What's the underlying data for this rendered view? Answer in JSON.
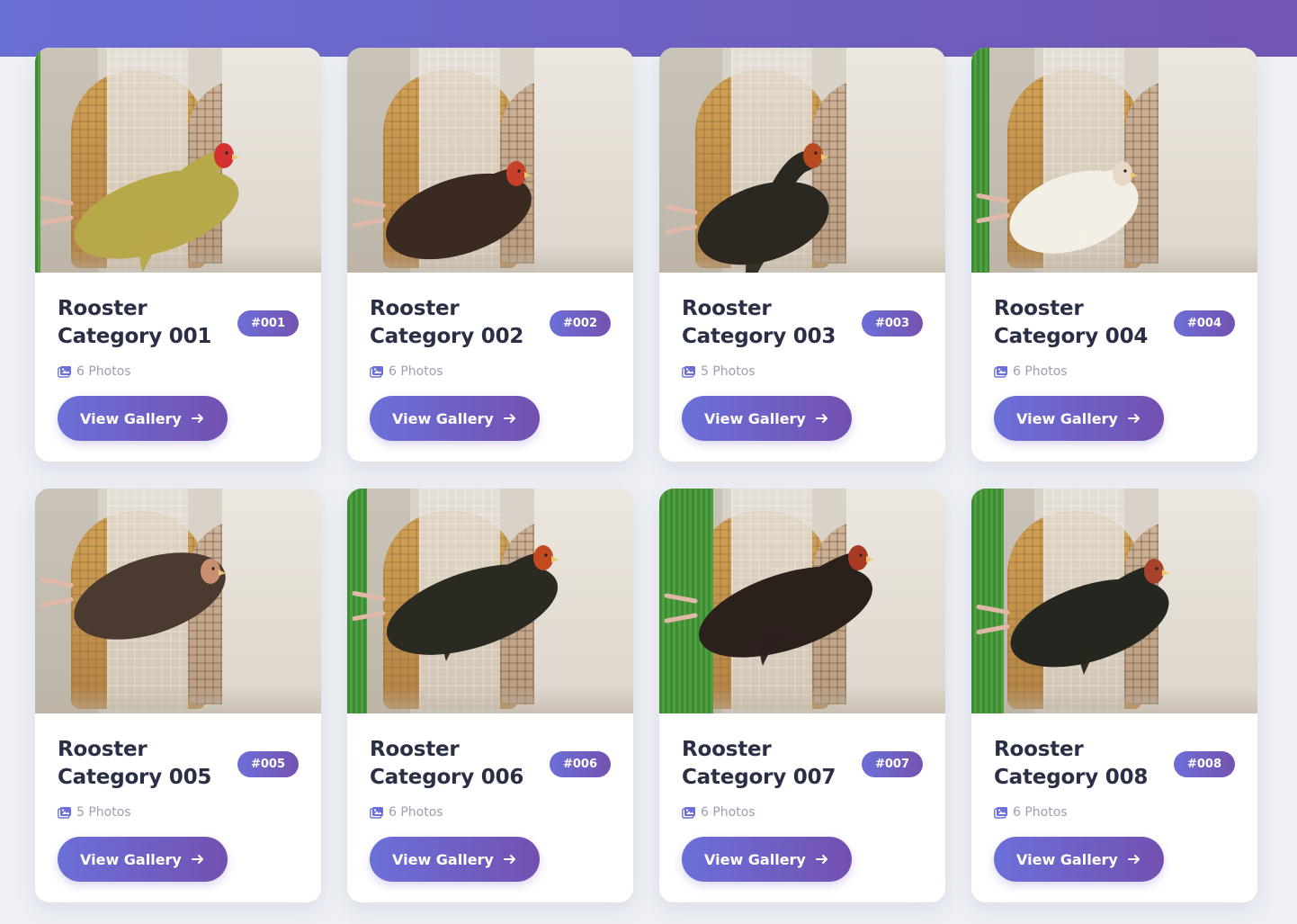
{
  "categories": [
    {
      "title": "Rooster Category 001",
      "badge": "#001",
      "photos": "6 Photos",
      "button": "View Gallery",
      "icon": "image-icon",
      "bird_color": "#b7a84a",
      "accent": "#d43030"
    },
    {
      "title": "Rooster Category 002",
      "badge": "#002",
      "photos": "6 Photos",
      "button": "View Gallery",
      "icon": "image-icon",
      "bird_color": "#3a2a22",
      "accent": "#c8402a"
    },
    {
      "title": "Rooster Category 003",
      "badge": "#003",
      "photos": "5 Photos",
      "button": "View Gallery",
      "icon": "image-icon",
      "bird_color": "#2a2820",
      "accent": "#b84a20"
    },
    {
      "title": "Rooster Category 004",
      "badge": "#004",
      "photos": "6 Photos",
      "button": "View Gallery",
      "icon": "image-icon",
      "bird_color": "#f2efe6",
      "accent": "#e8d8c8"
    },
    {
      "title": "Rooster Category 005",
      "badge": "#005",
      "photos": "5 Photos",
      "button": "View Gallery",
      "icon": "image-icon",
      "bird_color": "#4a3a30",
      "accent": "#c89070"
    },
    {
      "title": "Rooster Category 006",
      "badge": "#006",
      "photos": "6 Photos",
      "button": "View Gallery",
      "icon": "image-icon",
      "bird_color": "#2b2a22",
      "accent": "#c24a1e"
    },
    {
      "title": "Rooster Category 007",
      "badge": "#007",
      "photos": "6 Photos",
      "button": "View Gallery",
      "icon": "image-icon",
      "bird_color": "#2a201c",
      "accent": "#a83a22"
    },
    {
      "title": "Rooster Category 008",
      "badge": "#008",
      "photos": "6 Photos",
      "button": "View Gallery",
      "icon": "image-icon",
      "bird_color": "#262620",
      "accent": "#a8422a"
    }
  ],
  "colors": {
    "header_start": "#6a6fd6",
    "header_end": "#7256b3",
    "button_start": "#6b70d9",
    "button_end": "#7350b0",
    "page_bg": "#eef0f6"
  }
}
